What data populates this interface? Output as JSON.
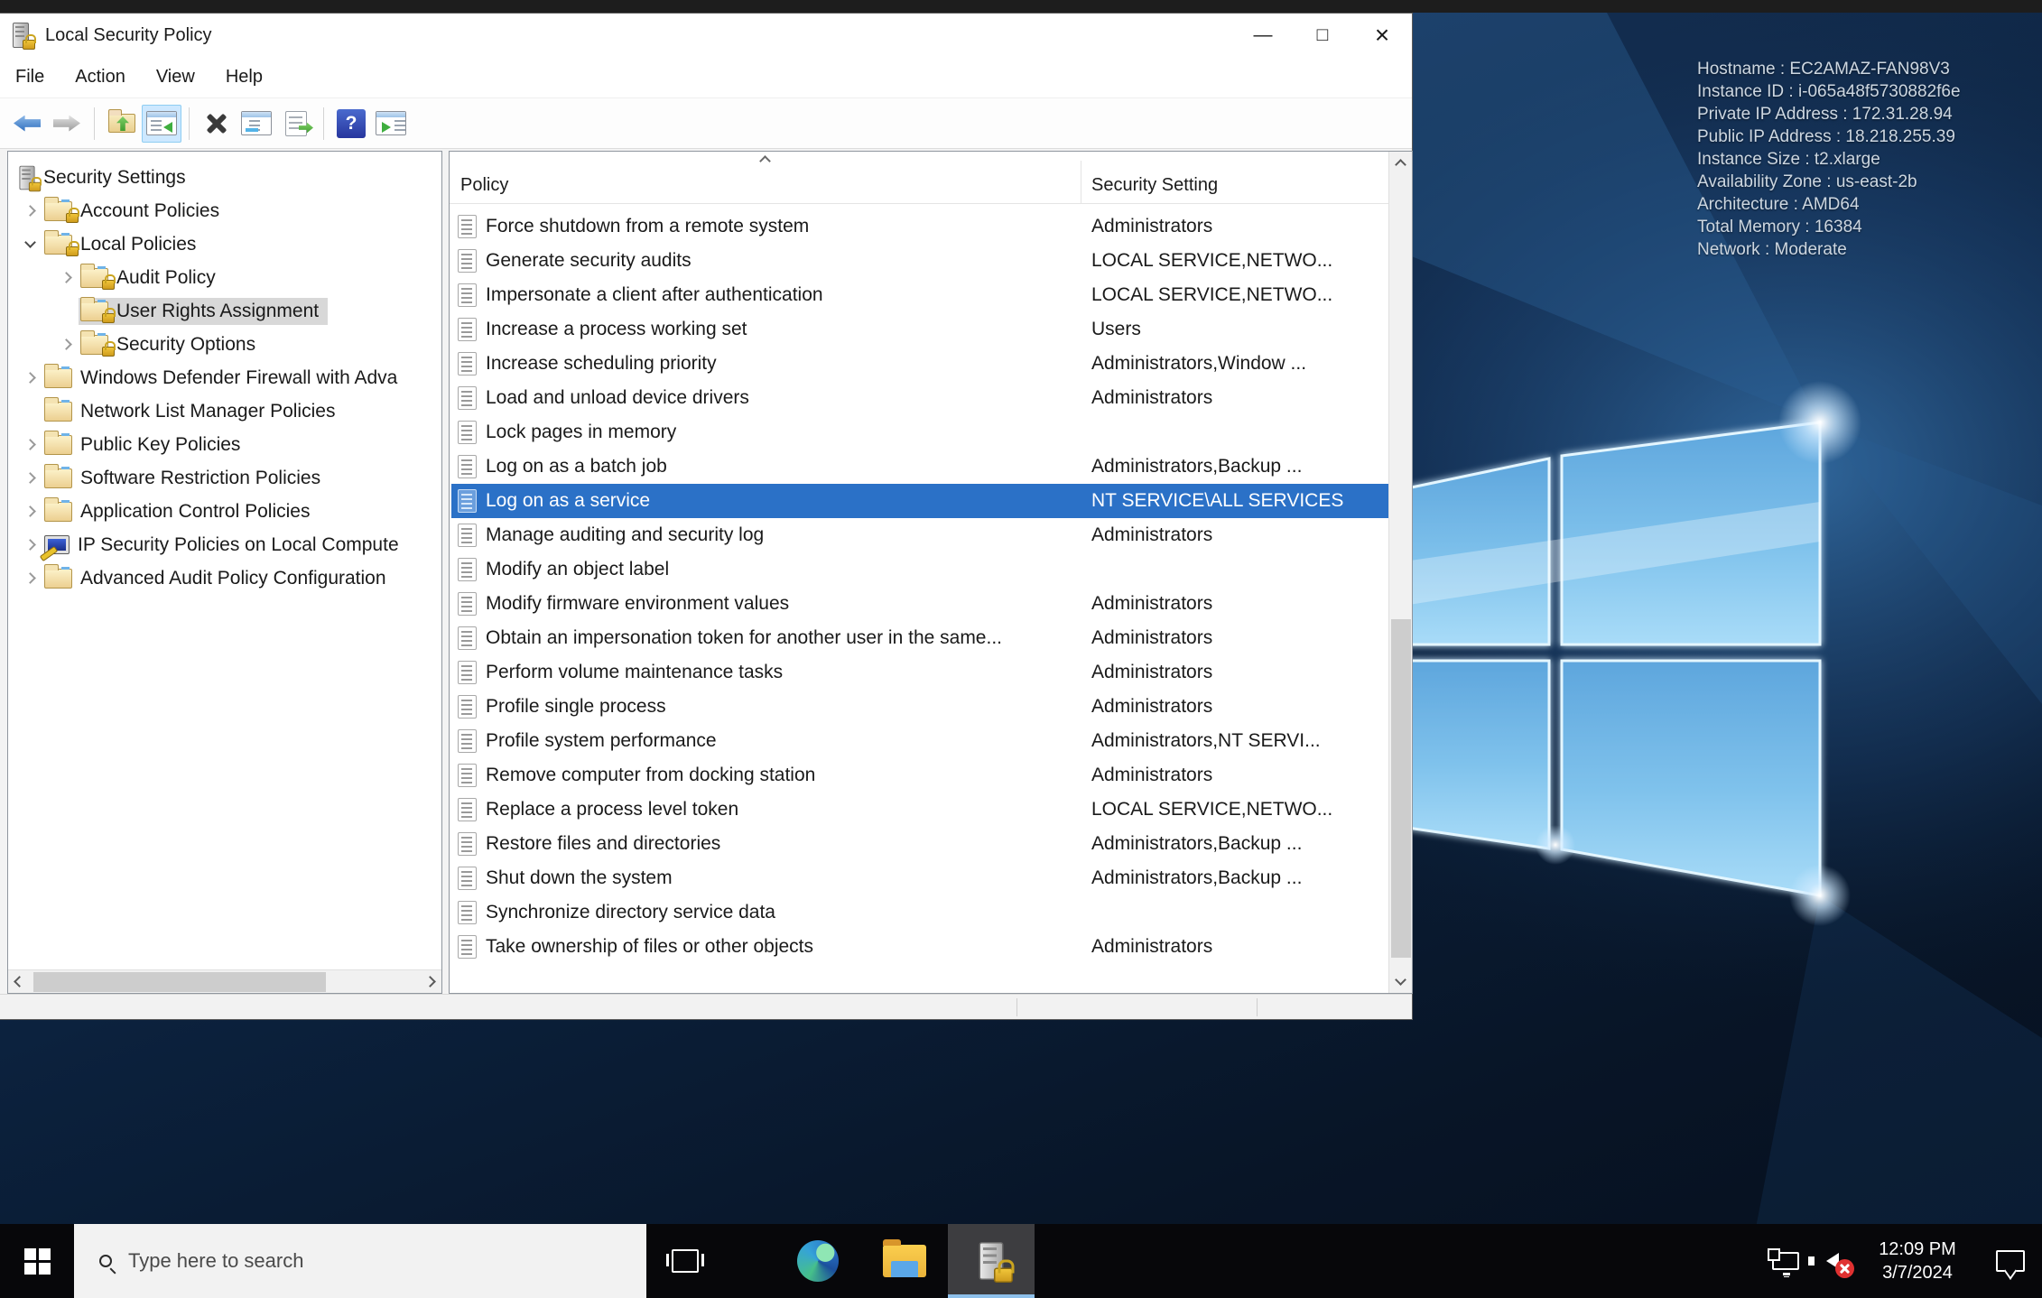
{
  "window": {
    "title": "Local Security Policy",
    "menu": [
      "File",
      "Action",
      "View",
      "Help"
    ],
    "controls": {
      "minimize": "—",
      "maximize": "□",
      "close": "×"
    }
  },
  "icons": {
    "help_glyph": "?"
  },
  "tree": {
    "items": [
      {
        "label": "Security Settings"
      },
      {
        "label": "Account Policies"
      },
      {
        "label": "Local Policies"
      },
      {
        "label": "Audit Policy"
      },
      {
        "label": "User Rights Assignment"
      },
      {
        "label": "Security Options"
      },
      {
        "label": "Windows Defender Firewall with Adva"
      },
      {
        "label": "Network List Manager Policies"
      },
      {
        "label": "Public Key Policies"
      },
      {
        "label": "Software Restriction Policies"
      },
      {
        "label": "Application Control Policies"
      },
      {
        "label": "IP Security Policies on Local Compute"
      },
      {
        "label": "Advanced Audit Policy Configuration"
      }
    ]
  },
  "list": {
    "columns": [
      "Policy",
      "Security Setting"
    ],
    "selected_index": 8,
    "rows": [
      {
        "policy": "Force shutdown from a remote system",
        "setting": "Administrators"
      },
      {
        "policy": "Generate security audits",
        "setting": "LOCAL SERVICE,NETWO..."
      },
      {
        "policy": "Impersonate a client after authentication",
        "setting": "LOCAL SERVICE,NETWO..."
      },
      {
        "policy": "Increase a process working set",
        "setting": "Users"
      },
      {
        "policy": "Increase scheduling priority",
        "setting": "Administrators,Window ..."
      },
      {
        "policy": "Load and unload device drivers",
        "setting": "Administrators"
      },
      {
        "policy": "Lock pages in memory",
        "setting": ""
      },
      {
        "policy": "Log on as a batch job",
        "setting": "Administrators,Backup ..."
      },
      {
        "policy": "Log on as a service",
        "setting": "NT SERVICE\\ALL SERVICES"
      },
      {
        "policy": "Manage auditing and security log",
        "setting": "Administrators"
      },
      {
        "policy": "Modify an object label",
        "setting": ""
      },
      {
        "policy": "Modify firmware environment values",
        "setting": "Administrators"
      },
      {
        "policy": "Obtain an impersonation token for another user in the same...",
        "setting": "Administrators"
      },
      {
        "policy": "Perform volume maintenance tasks",
        "setting": "Administrators"
      },
      {
        "policy": "Profile single process",
        "setting": "Administrators"
      },
      {
        "policy": "Profile system performance",
        "setting": "Administrators,NT SERVI..."
      },
      {
        "policy": "Remove computer from docking station",
        "setting": "Administrators"
      },
      {
        "policy": "Replace a process level token",
        "setting": "LOCAL SERVICE,NETWO..."
      },
      {
        "policy": "Restore files and directories",
        "setting": "Administrators,Backup ..."
      },
      {
        "policy": "Shut down the system",
        "setting": "Administrators,Backup ..."
      },
      {
        "policy": "Synchronize directory service data",
        "setting": ""
      },
      {
        "policy": "Take ownership of files or other objects",
        "setting": "Administrators"
      }
    ]
  },
  "desktop": {
    "info_lines": [
      "Hostname : EC2AMAZ-FAN98V3",
      "Instance ID : i-065a48f5730882f6e",
      "Private IP Address : 172.31.28.94",
      "Public IP Address : 18.218.255.39",
      "Instance Size : t2.xlarge",
      "Availability Zone : us-east-2b",
      "Architecture : AMD64",
      "Total Memory : 16384",
      "Network : Moderate"
    ]
  },
  "taskbar": {
    "search_placeholder": "Type here to search",
    "clock": {
      "time": "12:09 PM",
      "date": "3/7/2024"
    }
  }
}
